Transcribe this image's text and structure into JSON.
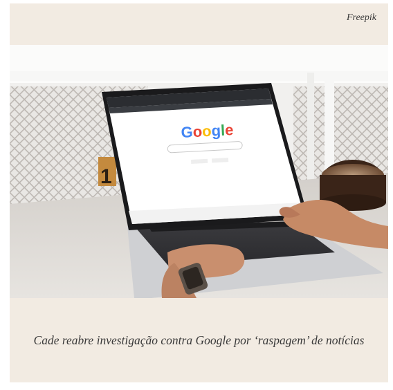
{
  "credit": "Freepik",
  "caption": "Cade reabre investigação contra Google por ‘raspagem’ de notícias",
  "screen": {
    "logo": {
      "letters": [
        {
          "char": "G",
          "color": "#4285f4"
        },
        {
          "char": "o",
          "color": "#ea4335"
        },
        {
          "char": "o",
          "color": "#fbbc05"
        },
        {
          "char": "g",
          "color": "#4285f4"
        },
        {
          "char": "l",
          "color": "#34a853"
        },
        {
          "char": "e",
          "color": "#ea4335"
        }
      ]
    }
  }
}
